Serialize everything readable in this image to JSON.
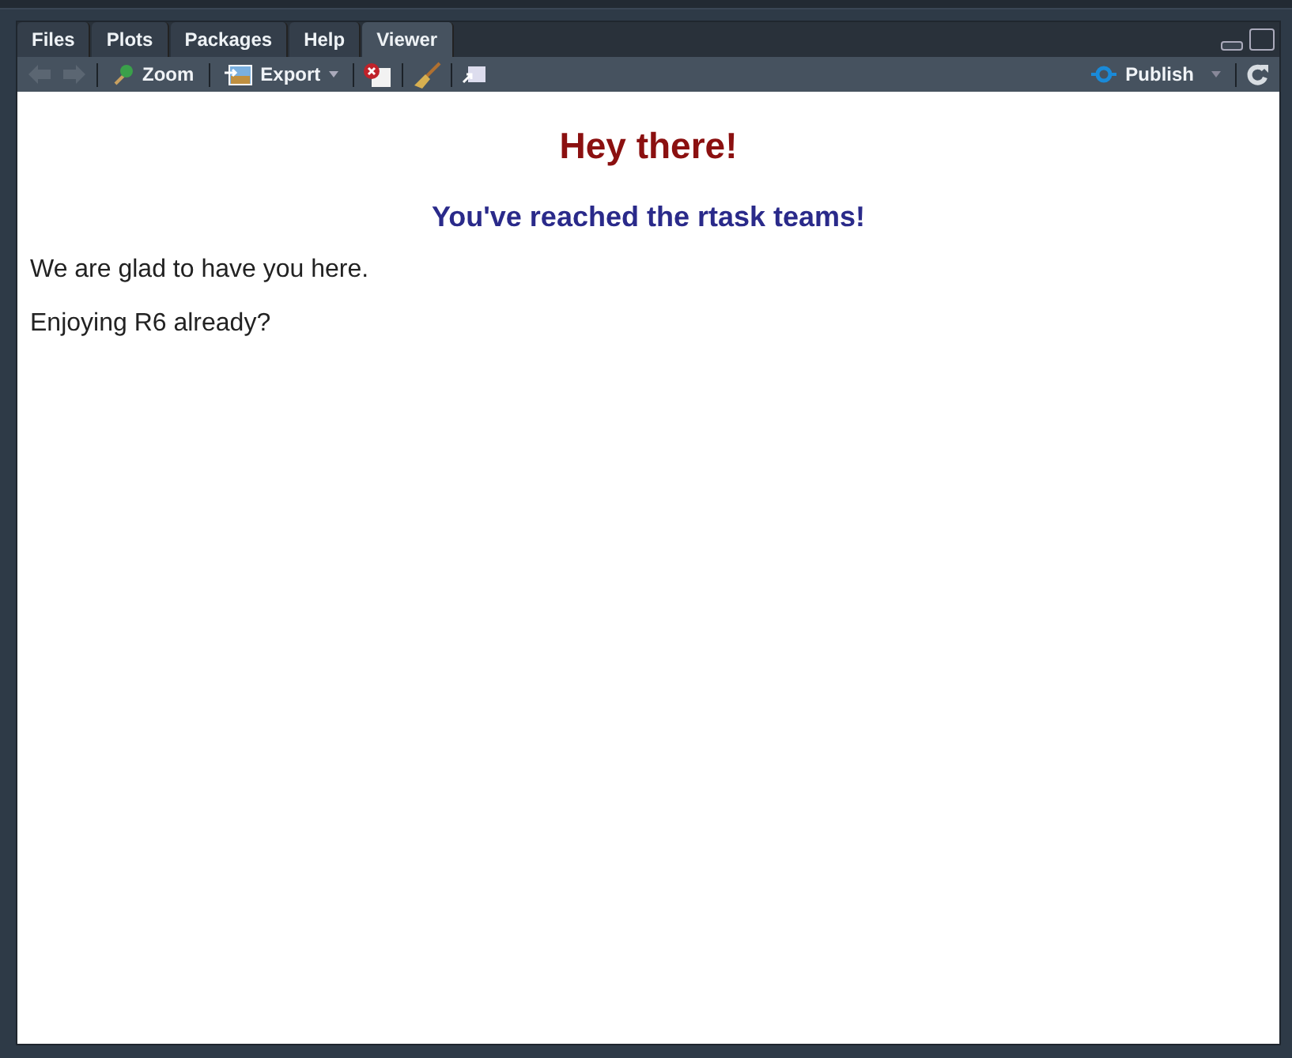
{
  "tabs": [
    {
      "label": "Files",
      "selected": false
    },
    {
      "label": "Plots",
      "selected": false
    },
    {
      "label": "Packages",
      "selected": false
    },
    {
      "label": "Help",
      "selected": false
    },
    {
      "label": "Viewer",
      "selected": true
    }
  ],
  "toolbar": {
    "zoom": "Zoom",
    "export": "Export",
    "publish": "Publish"
  },
  "content": {
    "heading": "Hey there!",
    "subheading": "You've reached the rtask teams!",
    "paragraphs": [
      "We are glad to have you here.",
      "Enjoying R6 already?"
    ]
  }
}
